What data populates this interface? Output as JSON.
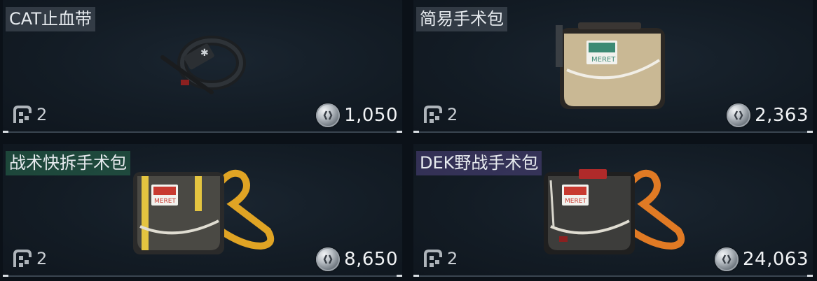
{
  "items": [
    {
      "name": "CAT止血带",
      "slots": "2",
      "price": "1,050",
      "rarity_color": "#5a646e"
    },
    {
      "name": "简易手术包",
      "slots": "2",
      "price": "2,363",
      "rarity_color": "#5a646e"
    },
    {
      "name": "战术快拆手术包",
      "slots": "2",
      "price": "8,650",
      "rarity_color": "#286e50"
    },
    {
      "name": "DEK野战手术包",
      "slots": "2",
      "price": "24,063",
      "rarity_color": "#504682"
    }
  ],
  "icons": {
    "slot": "grid-slot-icon",
    "currency": "silver-coin-icon"
  }
}
